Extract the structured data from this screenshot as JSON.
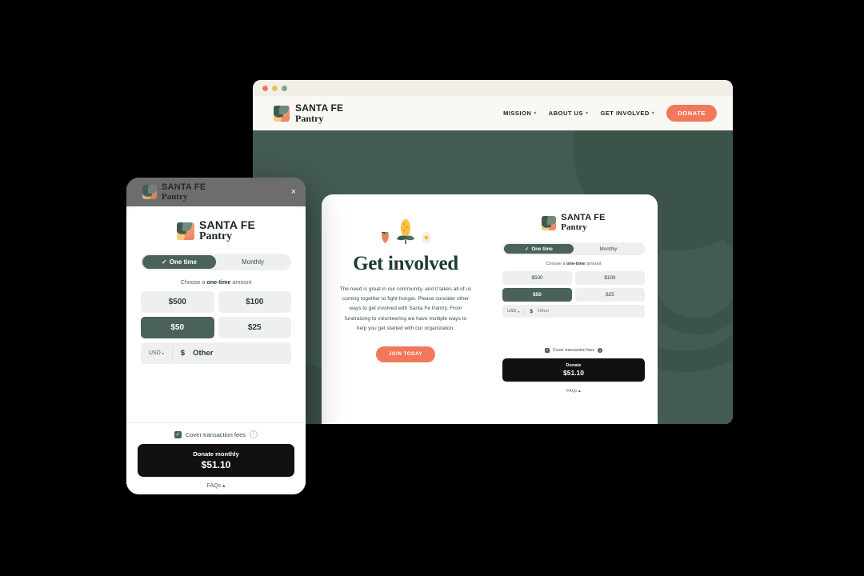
{
  "browser": {
    "traffic_lights": [
      "red",
      "yellow",
      "green"
    ]
  },
  "site": {
    "logo": {
      "line1": "SANTA FE",
      "line2": "Pantry",
      "icon": "pantry-logo-icon"
    },
    "nav": [
      {
        "label": "MISSION",
        "caret": "▾"
      },
      {
        "label": "ABOUT US",
        "caret": "▾"
      },
      {
        "label": "GET INVOLVED",
        "caret": "▾"
      }
    ],
    "donate_button": "DONATE"
  },
  "hero": {
    "veg_icons": [
      "berry-icon",
      "corn-icon",
      "egg-icon"
    ],
    "headline": "Get involved",
    "body": "The need is great in our community, and it takes all of us coming together to fight hunger. Please consider other ways to get involved with Santa Fe Pantry. From fundraising to volunteering we have multiple ways to help you get started with our organization.",
    "cta": "JOIN TODAY"
  },
  "widget": {
    "logo": {
      "line1": "SANTA FE",
      "line2": "Pantry"
    },
    "toggle": {
      "one_time": "One time",
      "monthly": "Monthly",
      "check": "✓",
      "active": "one_time"
    },
    "choose_prefix": "Choose a ",
    "choose_bold": "one-time",
    "choose_suffix": " amount",
    "amounts": [
      "$500",
      "$100",
      "$50",
      "$25"
    ],
    "selected_amount": "$50",
    "currency": "USD",
    "currency_caret": "▾",
    "dollar_sign": "$",
    "other_placeholder": "Other",
    "cover_fees": "Cover transaction fees",
    "cover_checked": "✓",
    "info_glyph": "?",
    "pay_label": "Donate",
    "pay_amount": "$51.10",
    "faqs": "FAQs ▴"
  },
  "mobile": {
    "dim_logo": {
      "line1": "SANTA FE",
      "line2": "Pantry"
    },
    "close": "×",
    "logo": {
      "line1": "SANTA FE",
      "line2": "Pantry"
    },
    "toggle": {
      "one_time": "One time",
      "monthly": "Monthly",
      "check": "✓"
    },
    "choose_prefix": "Choose a ",
    "choose_bold": "one-time",
    "choose_suffix": " amount",
    "amounts": [
      "$500",
      "$100",
      "$50",
      "$25"
    ],
    "selected_amount": "$50",
    "currency": "USD",
    "currency_caret": "▾",
    "dollar_sign": "$",
    "other_placeholder": "Other",
    "cover_fees": "Cover transaction fees",
    "cover_checked": "✓",
    "info_glyph": "i",
    "pay_label": "Donate monthly",
    "pay_amount": "$51.10",
    "faqs": "FAQs ▴"
  },
  "colors": {
    "green_dark": "#435b52",
    "green_accent": "#4a6257",
    "coral": "#f2785c",
    "cream": "#faf8f3",
    "black": "#12100e"
  }
}
